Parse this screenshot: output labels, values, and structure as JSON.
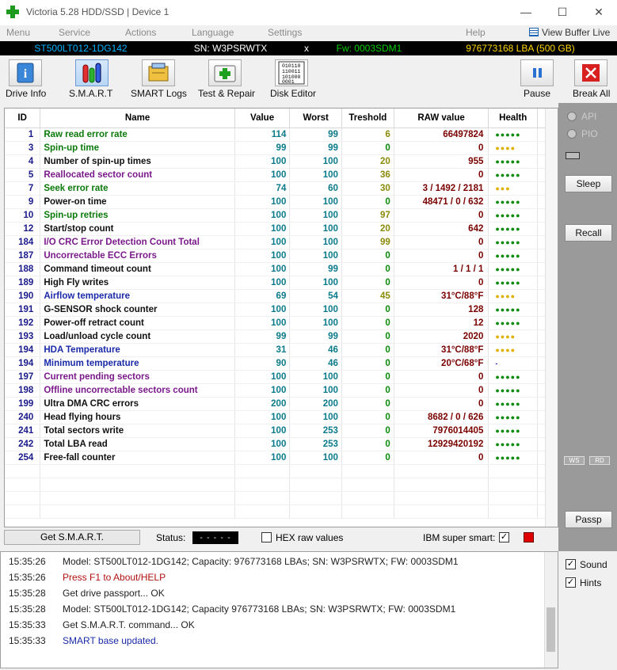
{
  "window": {
    "title": "Victoria 5.28 HDD/SSD | Device 1",
    "minimize": "—",
    "maximize": "☐",
    "close": "✕"
  },
  "menu": {
    "items": [
      "Menu",
      "Service",
      "Actions",
      "Language",
      "Settings",
      "Help"
    ],
    "view_buffer": "View Buffer Live"
  },
  "device": {
    "model": "ST500LT012-1DG142",
    "serial": "SN: W3PSRWTX",
    "close": "x",
    "firmware": "Fw: 0003SDM1",
    "capacity": "976773168 LBA (500 GB)"
  },
  "toolbar": {
    "drive_info": "Drive Info",
    "smart": "S.M.A.R.T",
    "smart_logs": "SMART Logs",
    "test_repair": "Test & Repair",
    "disk_editor": "Disk Editor",
    "pause": "Pause",
    "break_all": "Break All",
    "disk_editor_icon_text": "010110\n110011\n101000\n0001"
  },
  "table": {
    "headers": [
      "ID",
      "Name",
      "Value",
      "Worst",
      "Treshold",
      "RAW value",
      "Health"
    ],
    "rows": [
      {
        "id": "1",
        "name": "Raw read error rate",
        "value": "114",
        "worst": "99",
        "thr": "6",
        "raw": "66497824",
        "health": "●●●●●",
        "nc": "green",
        "vc": "teal",
        "tc": "olive",
        "rc": "",
        "hc": "green"
      },
      {
        "id": "3",
        "name": "Spin-up time",
        "value": "99",
        "worst": "99",
        "thr": "0",
        "raw": "0",
        "health": "●●●●",
        "nc": "green",
        "vc": "teal",
        "tc": "green",
        "rc": "",
        "hc": "yellow"
      },
      {
        "id": "4",
        "name": "Number of spin-up times",
        "value": "100",
        "worst": "100",
        "thr": "20",
        "raw": "955",
        "health": "●●●●●",
        "nc": "black",
        "vc": "teal",
        "tc": "olive",
        "rc": "",
        "hc": "green"
      },
      {
        "id": "5",
        "name": "Reallocated sector count",
        "value": "100",
        "worst": "100",
        "thr": "36",
        "raw": "0",
        "health": "●●●●●",
        "nc": "purple",
        "vc": "teal",
        "tc": "olive",
        "rc": "green",
        "hc": "green"
      },
      {
        "id": "7",
        "name": "Seek error rate",
        "value": "74",
        "worst": "60",
        "thr": "30",
        "raw": "3 / 1492 / 2181",
        "health": "●●●",
        "nc": "green",
        "vc": "teal",
        "tc": "olive",
        "rc": "",
        "hc": "yellow"
      },
      {
        "id": "9",
        "name": "Power-on time",
        "value": "100",
        "worst": "100",
        "thr": "0",
        "raw": "48471 / 0 / 632",
        "health": "●●●●●",
        "nc": "black",
        "vc": "teal",
        "tc": "green",
        "rc": "",
        "hc": "green"
      },
      {
        "id": "10",
        "name": "Spin-up retries",
        "value": "100",
        "worst": "100",
        "thr": "97",
        "raw": "0",
        "health": "●●●●●",
        "nc": "green",
        "vc": "teal",
        "tc": "olive",
        "rc": "",
        "hc": "green"
      },
      {
        "id": "12",
        "name": "Start/stop count",
        "value": "100",
        "worst": "100",
        "thr": "20",
        "raw": "642",
        "health": "●●●●●",
        "nc": "black",
        "vc": "teal",
        "tc": "olive",
        "rc": "",
        "hc": "green"
      },
      {
        "id": "184",
        "name": "I/O CRC Error Detection Count Total",
        "value": "100",
        "worst": "100",
        "thr": "99",
        "raw": "0",
        "health": "●●●●●",
        "nc": "purple",
        "vc": "teal",
        "tc": "olive",
        "rc": "green",
        "hc": "green"
      },
      {
        "id": "187",
        "name": "Uncorrectable ECC Errors",
        "value": "100",
        "worst": "100",
        "thr": "0",
        "raw": "0",
        "health": "●●●●●",
        "nc": "purple",
        "vc": "teal",
        "tc": "green",
        "rc": "green",
        "hc": "green"
      },
      {
        "id": "188",
        "name": "Command timeout count",
        "value": "100",
        "worst": "99",
        "thr": "0",
        "raw": "1 / 1 / 1",
        "health": "●●●●●",
        "nc": "black",
        "vc": "teal",
        "tc": "green",
        "rc": "",
        "hc": "green"
      },
      {
        "id": "189",
        "name": "High Fly writes",
        "value": "100",
        "worst": "100",
        "thr": "0",
        "raw": "0",
        "health": "●●●●●",
        "nc": "black",
        "vc": "teal",
        "tc": "green",
        "rc": "",
        "hc": "green"
      },
      {
        "id": "190",
        "name": "Airflow temperature",
        "value": "69",
        "worst": "54",
        "thr": "45",
        "raw": "31°C/88°F",
        "health": "●●●●",
        "nc": "blue",
        "vc": "teal",
        "tc": "olive",
        "rc": "blue",
        "hc": "yellow"
      },
      {
        "id": "191",
        "name": "G-SENSOR shock counter",
        "value": "100",
        "worst": "100",
        "thr": "0",
        "raw": "128",
        "health": "●●●●●",
        "nc": "black",
        "vc": "teal",
        "tc": "green",
        "rc": "red",
        "hc": "green"
      },
      {
        "id": "192",
        "name": "Power-off retract count",
        "value": "100",
        "worst": "100",
        "thr": "0",
        "raw": "12",
        "health": "●●●●●",
        "nc": "black",
        "vc": "teal",
        "tc": "green",
        "rc": "",
        "hc": "green"
      },
      {
        "id": "193",
        "name": "Load/unload cycle count",
        "value": "99",
        "worst": "99",
        "thr": "0",
        "raw": "2020",
        "health": "●●●●",
        "nc": "black",
        "vc": "teal",
        "tc": "green",
        "rc": "",
        "hc": "yellow"
      },
      {
        "id": "194",
        "name": "HDA Temperature",
        "value": "31",
        "worst": "46",
        "thr": "0",
        "raw": "31°C/88°F",
        "health": "●●●●",
        "nc": "blue",
        "vc": "teal",
        "tc": "green",
        "rc": "blue",
        "hc": "yellow"
      },
      {
        "id": "194",
        "name": "Minimum temperature",
        "value": "90",
        "worst": "46",
        "thr": "0",
        "raw": "20°C/68°F",
        "health": "-",
        "nc": "blue",
        "vc": "teal",
        "tc": "green",
        "rc": "blue",
        "hc": "blue"
      },
      {
        "id": "197",
        "name": "Current pending sectors",
        "value": "100",
        "worst": "100",
        "thr": "0",
        "raw": "0",
        "health": "●●●●●",
        "nc": "purple",
        "vc": "teal",
        "tc": "green",
        "rc": "green",
        "hc": "green"
      },
      {
        "id": "198",
        "name": "Offline uncorrectable sectors count",
        "value": "100",
        "worst": "100",
        "thr": "0",
        "raw": "0",
        "health": "●●●●●",
        "nc": "purple",
        "vc": "teal",
        "tc": "green",
        "rc": "green",
        "hc": "green"
      },
      {
        "id": "199",
        "name": "Ultra DMA CRC errors",
        "value": "200",
        "worst": "200",
        "thr": "0",
        "raw": "0",
        "health": "●●●●●",
        "nc": "black",
        "vc": "teal",
        "tc": "green",
        "rc": "green",
        "hc": "green"
      },
      {
        "id": "240",
        "name": "Head flying hours",
        "value": "100",
        "worst": "100",
        "thr": "0",
        "raw": "8682 / 0 / 626",
        "health": "●●●●●",
        "nc": "black",
        "vc": "teal",
        "tc": "green",
        "rc": "",
        "hc": "green"
      },
      {
        "id": "241",
        "name": "Total sectors write",
        "value": "100",
        "worst": "253",
        "thr": "0",
        "raw": "7976014405",
        "health": "●●●●●",
        "nc": "black",
        "vc": "teal",
        "tc": "green",
        "rc": "",
        "hc": "green"
      },
      {
        "id": "242",
        "name": "Total LBA read",
        "value": "100",
        "worst": "253",
        "thr": "0",
        "raw": "12929420192",
        "health": "●●●●●",
        "nc": "black",
        "vc": "teal",
        "tc": "green",
        "rc": "",
        "hc": "green"
      },
      {
        "id": "254",
        "name": "Free-fall counter",
        "value": "100",
        "worst": "100",
        "thr": "0",
        "raw": "0",
        "health": "●●●●●",
        "nc": "black",
        "vc": "teal",
        "tc": "green",
        "rc": "",
        "hc": "green"
      }
    ]
  },
  "status_row": {
    "get_smart": "Get S.M.A.R.T.",
    "status_label": "Status:",
    "status_value": "- - - - -",
    "hex_raw": "HEX raw values",
    "ibm_super_smart": "IBM super smart:",
    "ibm_checked": "✓"
  },
  "log": [
    {
      "time": "15:35:26",
      "text": "Model: ST500LT012-1DG142; Capacity: 976773168 LBAs; SN: W3PSRWTX; FW: 0003SDM1",
      "color": "#222222"
    },
    {
      "time": "15:35:26",
      "text": "Press F1 to About/HELP",
      "color": "#b01010"
    },
    {
      "time": "15:35:28",
      "text": "Get drive passport... OK",
      "color": "#222222"
    },
    {
      "time": "15:35:28",
      "text": "Model: ST500LT012-1DG142; Capacity 976773168 LBAs; SN: W3PSRWTX; FW: 0003SDM1",
      "color": "#222222"
    },
    {
      "time": "15:35:33",
      "text": "Get S.M.A.R.T. command... OK",
      "color": "#222222"
    },
    {
      "time": "15:35:33",
      "text": "SMART base updated.",
      "color": "#1a2aa8"
    }
  ],
  "right_panel": {
    "api": "API",
    "pio": "PIO",
    "sleep": "Sleep",
    "recall": "Recall",
    "ws": "WS",
    "rd": "RD",
    "passp": "Passp",
    "sound": "Sound",
    "hints": "Hints",
    "check": "✓"
  },
  "colors": {
    "device_model": "#00b4ff",
    "device_serial": "#ffffff",
    "device_fw": "#00d000",
    "device_capacity": "#ffd700"
  }
}
